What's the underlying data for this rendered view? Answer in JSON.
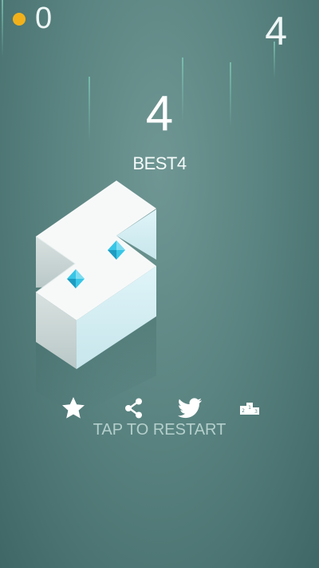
{
  "hud": {
    "coins": "0",
    "top_score": "4"
  },
  "game_over": {
    "score": "4",
    "best_label": "BEST",
    "best_value": "4",
    "restart_label": "TAP TO RESTART"
  },
  "actions": [
    {
      "name": "rate",
      "icon": "star-icon"
    },
    {
      "name": "share",
      "icon": "share-icon"
    },
    {
      "name": "twitter",
      "icon": "twitter-icon"
    },
    {
      "name": "leaderboard",
      "icon": "podium-icon"
    }
  ],
  "colors": {
    "background": "#5a8481",
    "coin": "#f2b11a",
    "gem": "#38c6e6",
    "block_top": "#f7f9f9",
    "block_left": "#c9d6d5",
    "block_right": "#d4eef3"
  }
}
